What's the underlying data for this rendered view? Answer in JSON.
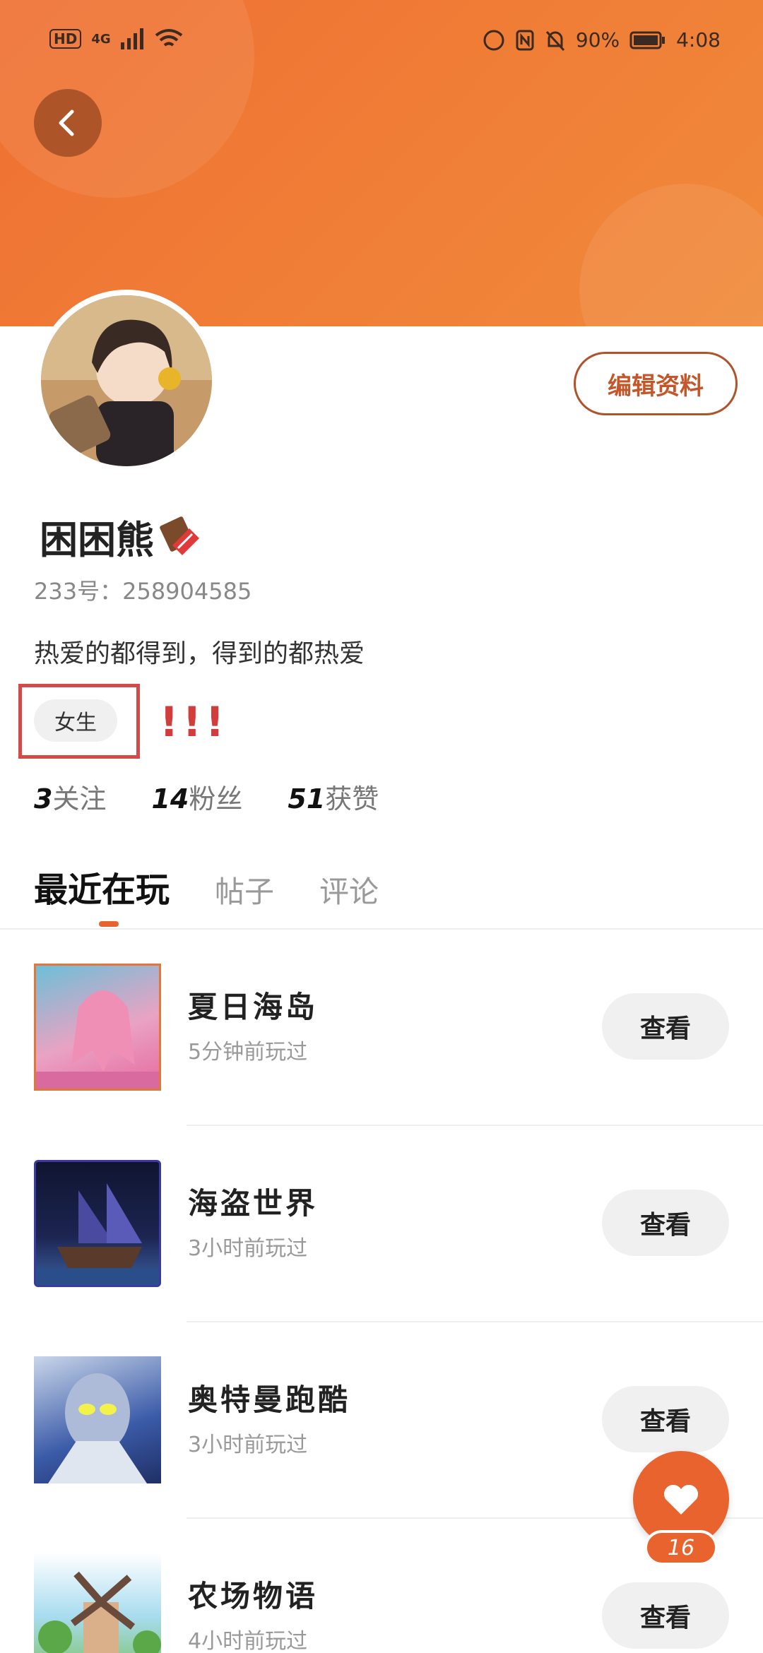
{
  "status_bar": {
    "left": {
      "hd": "HD",
      "network": "4G"
    },
    "right": {
      "battery": "90%",
      "time": "4:08"
    }
  },
  "profile": {
    "name": "困困熊",
    "uid_label": "233号：",
    "uid_value": "258904585",
    "bio": "热爱的都得到，得到的都热爱",
    "gender_tag": "女生",
    "annotation": "!!!",
    "edit_button": "编辑资料"
  },
  "stats": [
    {
      "value": "3",
      "label": "关注"
    },
    {
      "value": "14",
      "label": "粉丝"
    },
    {
      "value": "51",
      "label": "获赞"
    }
  ],
  "tabs": [
    {
      "label": "最近在玩",
      "active": true
    },
    {
      "label": "帖子",
      "active": false
    },
    {
      "label": "评论",
      "active": false
    }
  ],
  "games": [
    {
      "title": "夏日海岛",
      "time": "5分钟前玩过",
      "button": "查看",
      "thumb_colors": [
        "#e86aa0",
        "#6cbfd8"
      ]
    },
    {
      "title": "海盗世界",
      "time": "3小时前玩过",
      "button": "查看",
      "thumb_colors": [
        "#1c2450",
        "#3a5fa0"
      ]
    },
    {
      "title": "奥特曼跑酷",
      "time": "3小时前玩过",
      "button": "查看",
      "thumb_colors": [
        "#3b5ba8",
        "#c9d6ea"
      ]
    },
    {
      "title": "农场物语",
      "time": "4小时前玩过",
      "button": "查看",
      "thumb_colors": [
        "#6fc3e0",
        "#7ac060"
      ]
    }
  ],
  "like_fab": {
    "count": "16"
  },
  "colors": {
    "accent": "#e8632d",
    "header": "#ef7033",
    "tag_highlight": "#d34a4a"
  }
}
